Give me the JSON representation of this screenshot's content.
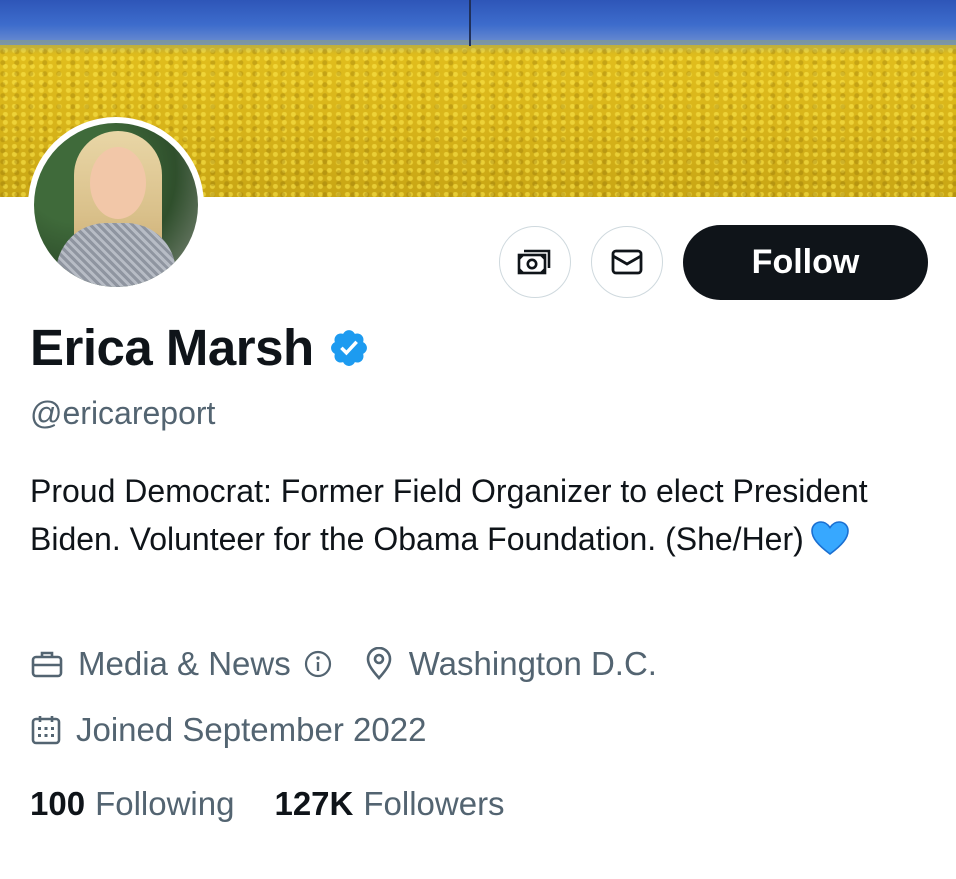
{
  "profile": {
    "name": "Erica Marsh",
    "handle": "@ericareport",
    "verified": true,
    "bio": "Proud Democrat: Former Field Organizer to elect President Biden. Volunteer for the Obama Foundation. (She/Her)",
    "bio_emoji": "blue-heart-icon",
    "category": "Media & News",
    "location": "Washington D.C.",
    "joined": "Joined September 2022",
    "following_count": "100",
    "following_label": "Following",
    "followers_count": "127K",
    "followers_label": "Followers"
  },
  "actions": {
    "follow_label": "Follow",
    "tip_icon": "money-icon",
    "message_icon": "envelope-icon"
  },
  "colors": {
    "verified_badge": "#1d9bf0",
    "follow_button_bg": "#0f1419",
    "secondary_text": "#536471",
    "heart": "#37a8ff"
  }
}
